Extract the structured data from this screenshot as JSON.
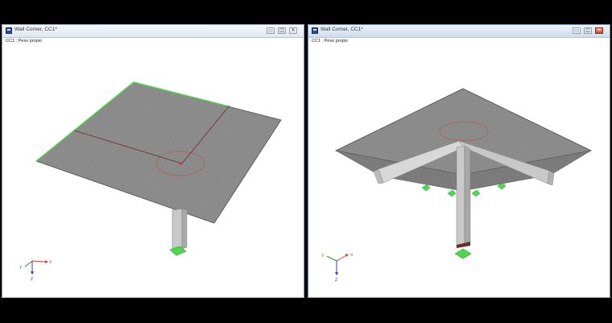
{
  "windows": [
    {
      "title": "Wall Corner, CC1*",
      "load_case": "CC1 : Peso propio",
      "axes": {
        "x": "X",
        "y": "Y",
        "z": "Z"
      }
    },
    {
      "title": "Wall Corner, CC1*",
      "load_case": "CC1 : Peso propio",
      "axes": {
        "x": "X",
        "y": "Y",
        "z": "Z"
      }
    }
  ],
  "colors": {
    "slab": "#8c8c8c",
    "support": "#4fd84f",
    "axis_x": "#d83a3a",
    "axis_y": "#2f8f2f",
    "axis_z": "#2a3fc8",
    "close_active": "#c8452c"
  },
  "icons": [
    "app-icon",
    "minimize-icon",
    "maximize-icon",
    "close-icon"
  ]
}
